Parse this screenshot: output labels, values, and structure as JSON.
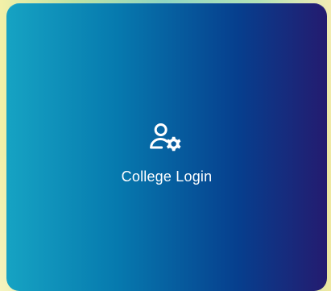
{
  "card": {
    "title": "College Login",
    "icon": "user-settings-icon"
  }
}
